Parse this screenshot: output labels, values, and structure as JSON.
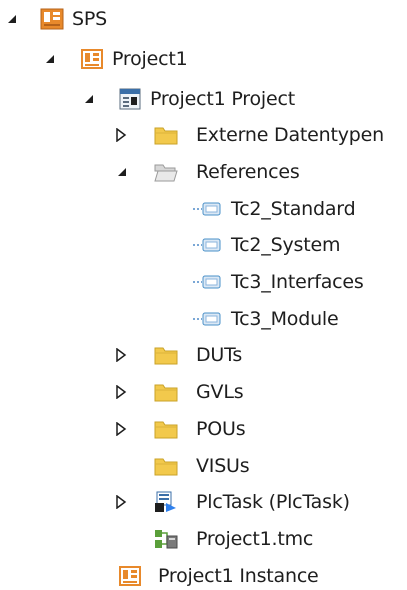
{
  "tree": {
    "nodes": [
      {
        "label": "SPS",
        "icon": "plc-orange-icon",
        "expander": "expanded"
      },
      {
        "label": "Project1",
        "icon": "plc-project-orange-icon",
        "expander": "expanded"
      },
      {
        "label": "Project1 Project",
        "icon": "plc-project-file-icon",
        "expander": "expanded"
      },
      {
        "label": "Externe Datentypen",
        "icon": "folder-icon",
        "expander": "collapsed"
      },
      {
        "label": "References",
        "icon": "folder-open-gray-icon",
        "expander": "expanded"
      },
      {
        "label": "Tc2_Standard",
        "icon": "library-reference-icon",
        "expander": "none"
      },
      {
        "label": "Tc2_System",
        "icon": "library-reference-icon",
        "expander": "none"
      },
      {
        "label": "Tc3_Interfaces",
        "icon": "library-reference-icon",
        "expander": "none"
      },
      {
        "label": "Tc3_Module",
        "icon": "library-reference-icon",
        "expander": "none"
      },
      {
        "label": "DUTs",
        "icon": "folder-icon",
        "expander": "collapsed"
      },
      {
        "label": "GVLs",
        "icon": "folder-icon",
        "expander": "collapsed"
      },
      {
        "label": "POUs",
        "icon": "folder-icon",
        "expander": "collapsed"
      },
      {
        "label": "VISUs",
        "icon": "folder-icon",
        "expander": "none"
      },
      {
        "label": "PlcTask (PlcTask)",
        "icon": "plc-task-icon",
        "expander": "collapsed"
      },
      {
        "label": "Project1.tmc",
        "icon": "tmc-file-icon",
        "expander": "none"
      },
      {
        "label": "Project1 Instance",
        "icon": "plc-instance-icon",
        "expander": "none"
      }
    ]
  },
  "colors": {
    "text": "#1e1e1e",
    "folder_fill": "#f2c94c",
    "folder_stroke": "#c9a227",
    "plc_orange": "#e8892b",
    "reference_blue": "#4a90c8"
  }
}
